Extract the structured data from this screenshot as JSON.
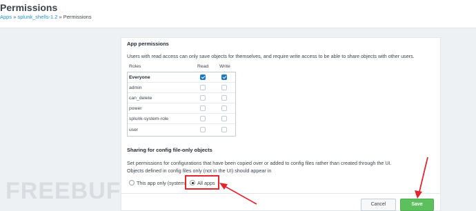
{
  "page": {
    "title": "Permissions"
  },
  "breadcrumb": {
    "apps": "Apps",
    "sep1": " » ",
    "app": "splunk_shells-1.2",
    "sep2": " » ",
    "current": "Permissions"
  },
  "app_permissions": {
    "title": "App permissions",
    "description": "Users with read access can only save objects for themselves, and require write access to be able to share objects with other users.",
    "columns": {
      "roles": "Roles",
      "read": "Read",
      "write": "Write"
    },
    "rows": [
      {
        "role": "Everyone",
        "read": true,
        "write": true
      },
      {
        "role": "admin",
        "read": false,
        "write": false
      },
      {
        "role": "can_delete",
        "read": false,
        "write": false
      },
      {
        "role": "power",
        "read": false,
        "write": false
      },
      {
        "role": "splunk-system-role",
        "read": false,
        "write": false
      },
      {
        "role": "user",
        "read": false,
        "write": false
      }
    ]
  },
  "sharing": {
    "title": "Sharing for config file-only objects",
    "description1": "Set permissions for configurations that have been copied over or added to config files rather than created through the UI.",
    "description2": "Objects defined in config files only (not in the UI) should appear in",
    "options": [
      {
        "label": "This app only (system)",
        "selected": false
      },
      {
        "label": "All apps",
        "selected": true
      }
    ]
  },
  "footer": {
    "cancel_label": "Cancel",
    "save_label": "Save"
  },
  "watermark": {
    "text": "FREEBUF"
  },
  "colors": {
    "accent": "#1a78c2",
    "save": "#5cc05c",
    "annotation": "#e4252f",
    "link": "#1e93c6"
  }
}
